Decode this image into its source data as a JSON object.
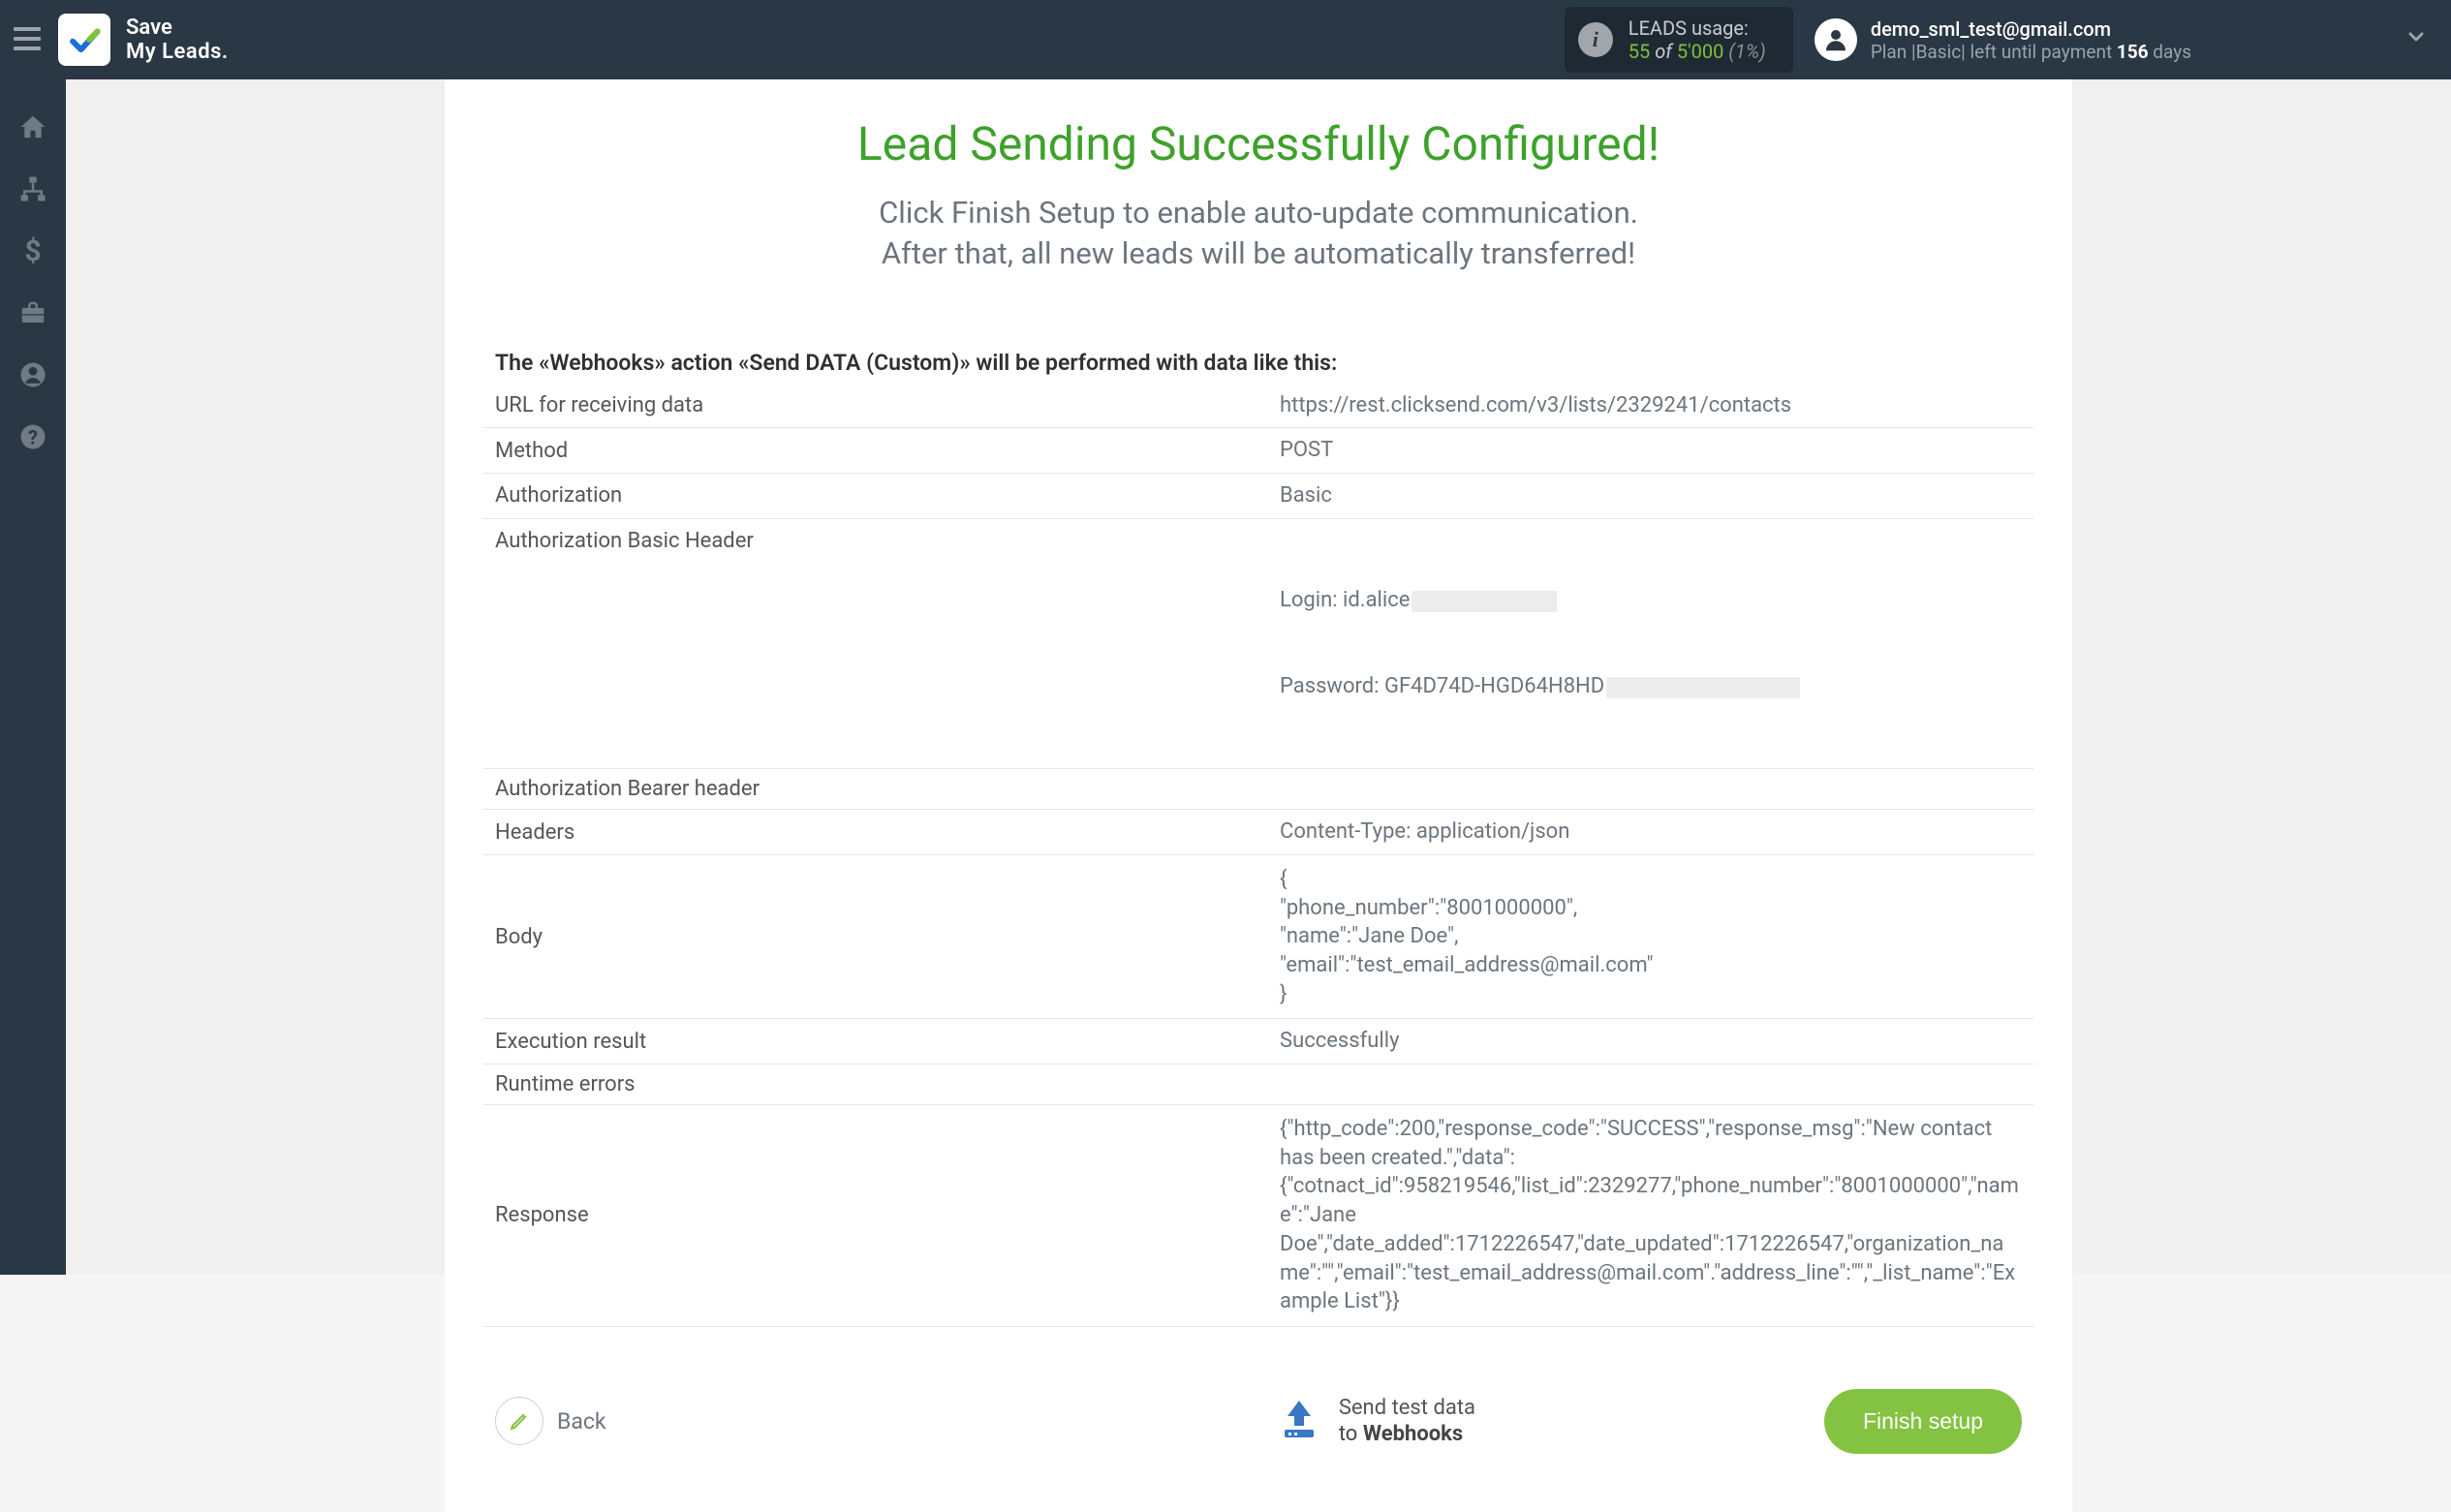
{
  "brand": {
    "line1": "Save",
    "line2": "My Leads."
  },
  "usage": {
    "label": "LEADS usage:",
    "used": "55",
    "of": " of ",
    "max": "5'000",
    "pct": " (1%)"
  },
  "account": {
    "email": "demo_sml_test@gmail.com",
    "plan_prefix": "Plan |Basic| left until payment ",
    "days": "156",
    "days_suffix": " days"
  },
  "content": {
    "title": "Lead Sending Successfully Configured!",
    "subtitle_l1": "Click Finish Setup to enable auto-update communication.",
    "subtitle_l2": "After that, all new leads will be automatically transferred!",
    "intro": "The «Webhooks» action «Send DATA (Custom)» will be performed with data like this:",
    "rows": {
      "url_label": "URL for receiving data",
      "url_value": "https://rest.clicksend.com/v3/lists/2329241/contacts",
      "method_label": "Method",
      "method_value": "POST",
      "auth_label": "Authorization",
      "auth_value": "Basic",
      "auth_basic_label": "Authorization Basic Header",
      "auth_basic_login_prefix": "Login: id.alice",
      "auth_basic_pass_prefix": "Password: GF4D74D-HGD64H8HD",
      "auth_bearer_label": "Authorization Bearer header",
      "auth_bearer_value": "",
      "headers_label": "Headers",
      "headers_value": "Content-Type: application/json",
      "body_label": "Body",
      "body_value": "{\n\"phone_number\":\"8001000000\",\n\"name\":\"Jane Doe\",\n\"email\":\"test_email_address@mail.com\"\n}",
      "exec_label": "Execution result",
      "exec_value": "Successfully",
      "runtime_label": "Runtime errors",
      "runtime_value": "",
      "response_label": "Response",
      "response_value": "{\"http_code\":200,\"response_code\":\"SUCCESS\",\"response_msg\":\"New contact has been created.\",\"data\":{\"cotnact_id\":958219546,\"list_id\":2329277,\"phone_number\":\"8001000000\",\"name\":\"Jane Doe\",\"date_added\":1712226547,\"date_updated\":1712226547,\"organization_name\":\"\",\"email\":\"test_email_address@mail.com\".\"address_line\":\"\",\"_list_name\":\"Example List\"}}"
    }
  },
  "footer": {
    "back": "Back",
    "send_l1": "Send test data",
    "send_l2_prefix": "to ",
    "send_l2_bold": "Webhooks",
    "finish": "Finish setup"
  }
}
